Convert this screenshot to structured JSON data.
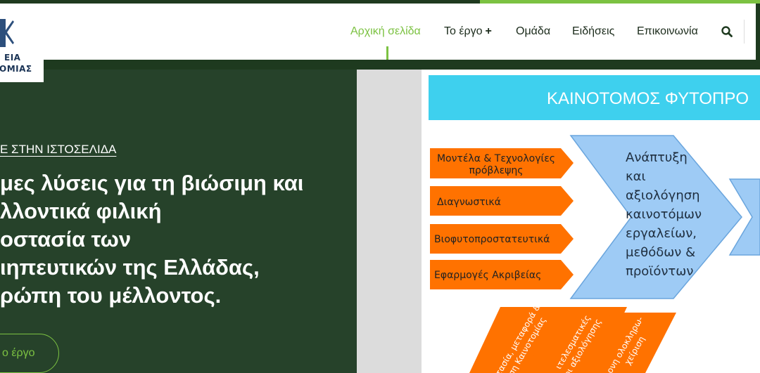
{
  "logo": {
    "line1": "ΕΙΑ",
    "line2": "ΟΜΙΑΣ"
  },
  "nav": {
    "items": [
      {
        "label": "Αρχική σελίδα",
        "active": true
      },
      {
        "label": "Το έργο",
        "has_submenu": true,
        "submenu_symbol": "+"
      },
      {
        "label": "Ομάδα"
      },
      {
        "label": "Ειδήσεις"
      },
      {
        "label": "Επικοινωνία"
      }
    ],
    "search_icon": "search-icon"
  },
  "hero": {
    "kicker": "Ε ΣΤΗΝ ΙΣΤΟΣΕΛΙΔΑ",
    "title_lines": [
      "μες λύσεις για τη βιώσιμη και",
      "λλοντικά φιλική",
      "οστασία των",
      "ιηπευτικών της Ελλάδας,",
      "ρώπη του μέλλοντος."
    ],
    "cta_label": "ο έργο"
  },
  "graphic": {
    "banner": "ΚΑΙΝΟΤΟΜΟΣ ΦΥΤΟΠΡΟ",
    "left_arrows": [
      [
        "Μοντέλα & Τεχνολογίες",
        "πρόβλεψης"
      ],
      [
        "Διαγνωστικά"
      ],
      [
        "Βιοφυτοπροστατευτικά"
      ],
      [
        "Εφαρμογές Ακριβείας"
      ]
    ],
    "chevron_lines": [
      "Ανάπτυξη",
      "και",
      "αξιολόγηση",
      "καινοτόμων",
      "εργαλείων,",
      "μεθόδων &",
      "προϊόντων"
    ],
    "bottom_arrows": [
      [
        "στασία, μεταφορά &",
        "ιση Καινοτομίας"
      ],
      [
        "ιτελεσματικές",
        "οι αξιολόγησης"
      ],
      [
        "ονη ολοκληρω-",
        "χείριση"
      ]
    ],
    "colors": {
      "banner": "#3ed0ee",
      "orange": "#ff7200",
      "blue": "#9ecbf5",
      "green_dark": "#26422a",
      "accent": "#7cc242"
    }
  }
}
